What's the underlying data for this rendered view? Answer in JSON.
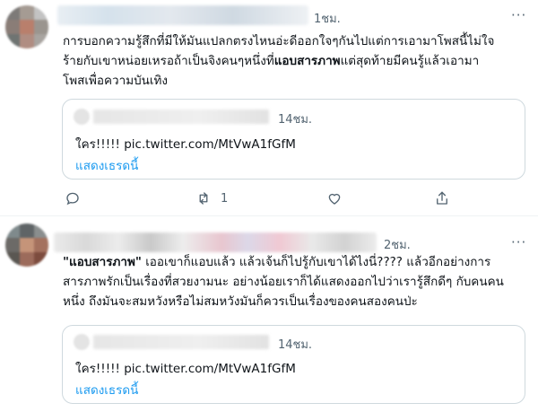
{
  "tweets": [
    {
      "time": "1ชม.",
      "more": "···",
      "text_lines": [
        "การบอกความรู้สึกที่มีให้มันแปลกตรงไหนอ่ะดีออกใจๆกันไปแต่การเอามาโพสนี้ไม่ใจ",
        "ร้ายกับเขาหน่อยเหรอถ้าเป็นจิงคนๆหนึ่งที่",
        "แอบสารภาพ",
        "แต่สุดท้ายมีคนรู้แล้วเอามา",
        "โพสเพื่อความบันเทิง"
      ],
      "quote": {
        "time": "14ชม.",
        "text": "ใคร!!!!! pic.twitter.com/MtVwA1fGfM",
        "show_thread": "แสดงเธรดนี้"
      },
      "actions": {
        "reply": "",
        "retweet": "1",
        "like": "",
        "share": ""
      }
    },
    {
      "time": "2ชม.",
      "more": "···",
      "text_lines": [
        "\"แอบสารภาพ\"",
        " เออเขาก็แอบแล้ว แล้วเจ้นก็ไปรู้กับเขาได้ไงนี่???? แล้วอีกอย่างการ",
        "สารภาพรักเป็นเรื่องที่สวยงามนะ อย่างน้อยเราก็ได้แสดงออกไปว่าเรารู้สึกดีๆ กับคนคน",
        "หนึ่ง ถึงมันจะสมหวังหรือไม่สมหวังมันก็ควรเป็นเรื่องของคนสองคนป่ะ"
      ],
      "quote": {
        "time": "14ชม.",
        "text": "ใคร!!!!! pic.twitter.com/MtVwA1fGfM",
        "show_thread": "แสดงเธรดนี้"
      }
    }
  ],
  "colors": {
    "link": "#1d9bf0",
    "muted": "#536471",
    "text": "#0f1419",
    "border": "#cfd9de"
  }
}
